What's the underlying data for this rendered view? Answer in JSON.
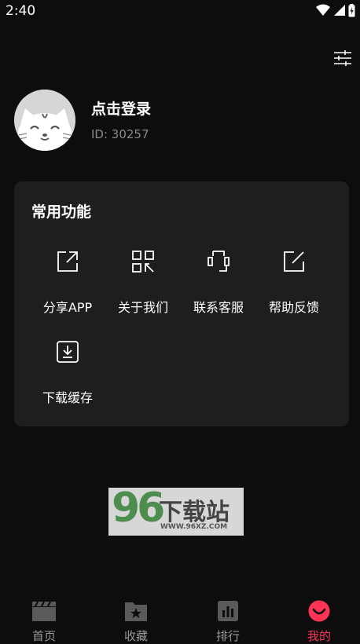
{
  "status_bar": {
    "time": "2:40"
  },
  "profile": {
    "login_label": "点击登录",
    "user_id": "ID: 30257"
  },
  "common_functions": {
    "title": "常用功能",
    "items": [
      {
        "label": "分享APP",
        "icon": "share-icon"
      },
      {
        "label": "关于我们",
        "icon": "qr-code-icon"
      },
      {
        "label": "联系客服",
        "icon": "headset-icon"
      },
      {
        "label": "帮助反馈",
        "icon": "edit-icon"
      },
      {
        "label": "下载缓存",
        "icon": "download-icon"
      }
    ]
  },
  "watermark": {
    "digits": "96",
    "brand": "下载站",
    "url": "WWW.96XZ.COM"
  },
  "tab_bar": {
    "items": [
      {
        "label": "首页",
        "icon": "clapperboard-icon"
      },
      {
        "label": "收藏",
        "icon": "star-folder-icon"
      },
      {
        "label": "排行",
        "icon": "bar-chart-icon"
      },
      {
        "label": "我的",
        "icon": "smile-icon",
        "active": true
      }
    ]
  },
  "colors": {
    "background": "#0d0d0d",
    "card": "#1e1e1e",
    "accent": "#ff3355",
    "secondary_text": "#8a8a8a"
  }
}
